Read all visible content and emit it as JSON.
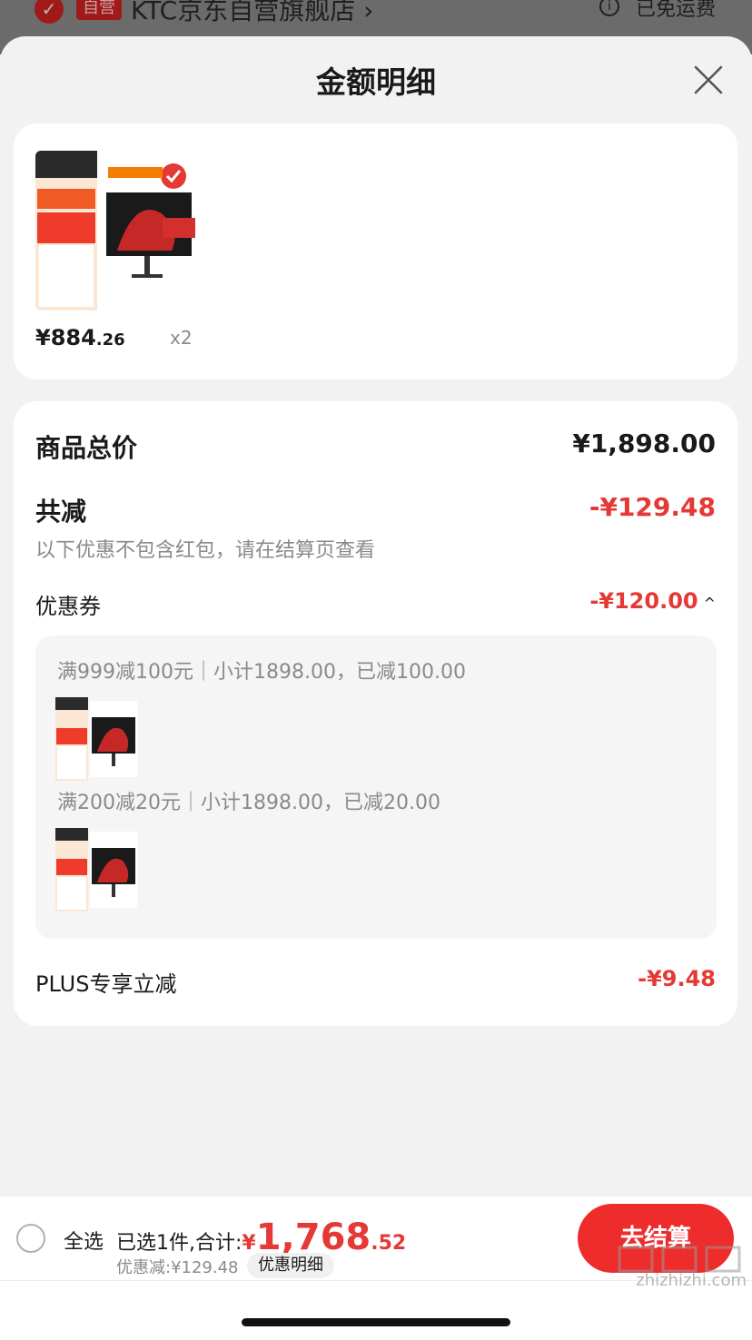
{
  "background_header": {
    "badge": "自营",
    "shop_name": "KTC京东自营旗舰店 ›",
    "shipping": "已免运费"
  },
  "sheet": {
    "title": "金额明细"
  },
  "product": {
    "price_main": "¥884",
    "price_cents": ".26",
    "quantity": "x2"
  },
  "summary": {
    "total_label": "商品总价",
    "total_value": "¥1,898.00",
    "reduce_label": "共减",
    "reduce_value": "-¥129.48",
    "note": "以下优惠不包含红包，请在结算页查看",
    "coupon_label": "优惠券",
    "coupon_value": "-¥120.00",
    "coupons": [
      {
        "text": "满999减100元｜小计1898.00，已减100.00"
      },
      {
        "text": "满200减20元｜小计1898.00，已减20.00"
      }
    ],
    "plus_label": "PLUS专享立减",
    "plus_value": "-¥9.48"
  },
  "bottom_bar": {
    "select_all": "全选",
    "selected_prefix": "已选1件,合计:",
    "total_yen": "¥",
    "total_main": "1,768",
    "total_cents": ".52",
    "discount_text": "优惠减:¥129.48",
    "detail_link": "优惠明细",
    "checkout": "去结算"
  },
  "watermark": "zhizhizhi.com",
  "colors": {
    "accent_red": "#e53935",
    "button_red": "#ee2c2c",
    "card_bg": "#ffffff",
    "page_bg": "#f2f2f2"
  }
}
